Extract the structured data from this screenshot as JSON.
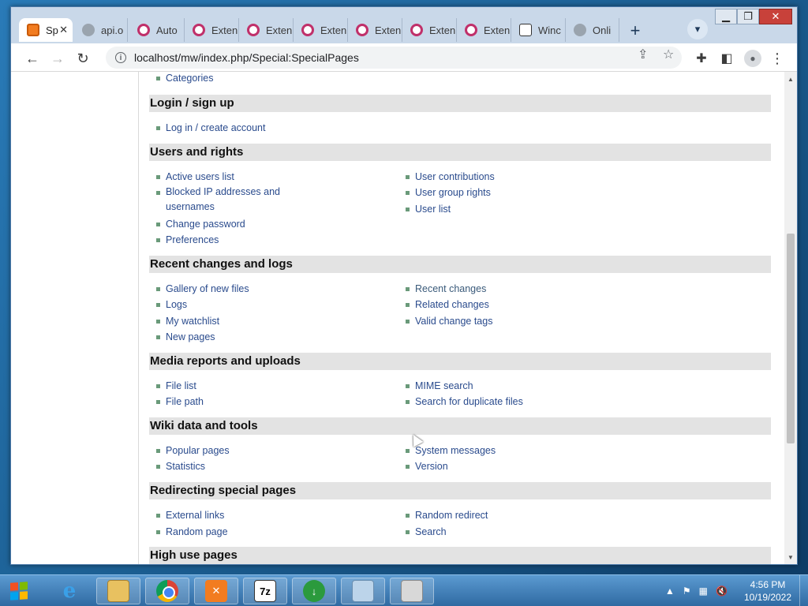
{
  "browser": {
    "tabs": [
      {
        "label": "Sp",
        "icon": "xampp-icon",
        "active": true
      },
      {
        "label": "api.o",
        "icon": "globe-icon"
      },
      {
        "label": "Auto",
        "icon": "extension-page-icon"
      },
      {
        "label": "Exten",
        "icon": "extension-page-icon"
      },
      {
        "label": "Exten",
        "icon": "extension-page-icon"
      },
      {
        "label": "Exten",
        "icon": "extension-page-icon"
      },
      {
        "label": "Exten",
        "icon": "extension-page-icon"
      },
      {
        "label": "Exten",
        "icon": "extension-page-icon"
      },
      {
        "label": "Exten",
        "icon": "extension-page-icon"
      },
      {
        "label": "Winc",
        "icon": "wiki-icon"
      },
      {
        "label": "Onli",
        "icon": "globe-icon"
      }
    ],
    "new_tab_glyph": "+",
    "url": "localhost/mw/index.php/Special:SpecialPages"
  },
  "page": {
    "top_partial": "Categories",
    "sections": [
      {
        "title": "Login / sign up",
        "left": [
          "Log in / create account"
        ],
        "right": []
      },
      {
        "title": "Users and rights",
        "left": [
          "Active users list",
          "Blocked IP addresses and usernames",
          "Change password",
          "Preferences"
        ],
        "right": [
          "User contributions",
          "User group rights",
          "User list"
        ]
      },
      {
        "title": "Recent changes and logs",
        "left": [
          "Gallery of new files",
          "Logs",
          "My watchlist",
          "New pages"
        ],
        "right": [
          "Recent changes",
          "Related changes",
          "Valid change tags"
        ]
      },
      {
        "title": "Media reports and uploads",
        "left": [
          "File list",
          "File path"
        ],
        "right": [
          "MIME search",
          "Search for duplicate files"
        ]
      },
      {
        "title": "Wiki data and tools",
        "left": [
          "Popular pages",
          "Statistics"
        ],
        "right": [
          "System messages",
          "Version"
        ]
      },
      {
        "title": "Redirecting special pages",
        "left": [
          "External links",
          "Random page"
        ],
        "right": [
          "Random redirect",
          "Search"
        ]
      },
      {
        "title": "High use pages",
        "left": [],
        "right": []
      }
    ]
  },
  "taskbar": {
    "apps": [
      "internet-explorer-icon",
      "file-explorer-icon",
      "chrome-icon",
      "xampp-icon",
      "7zip-icon",
      "download-manager-icon",
      "notepad-icon",
      "recycle-icon"
    ],
    "labels": {
      "seven_zip": "7z"
    },
    "clock_time": "4:56 PM",
    "clock_date": "10/19/2022"
  },
  "colors": {
    "link": "#2a4b8d",
    "visited_link": "#3a5a7a",
    "section_bg": "#e3e3e3",
    "bullet": "#6a9a7a"
  }
}
